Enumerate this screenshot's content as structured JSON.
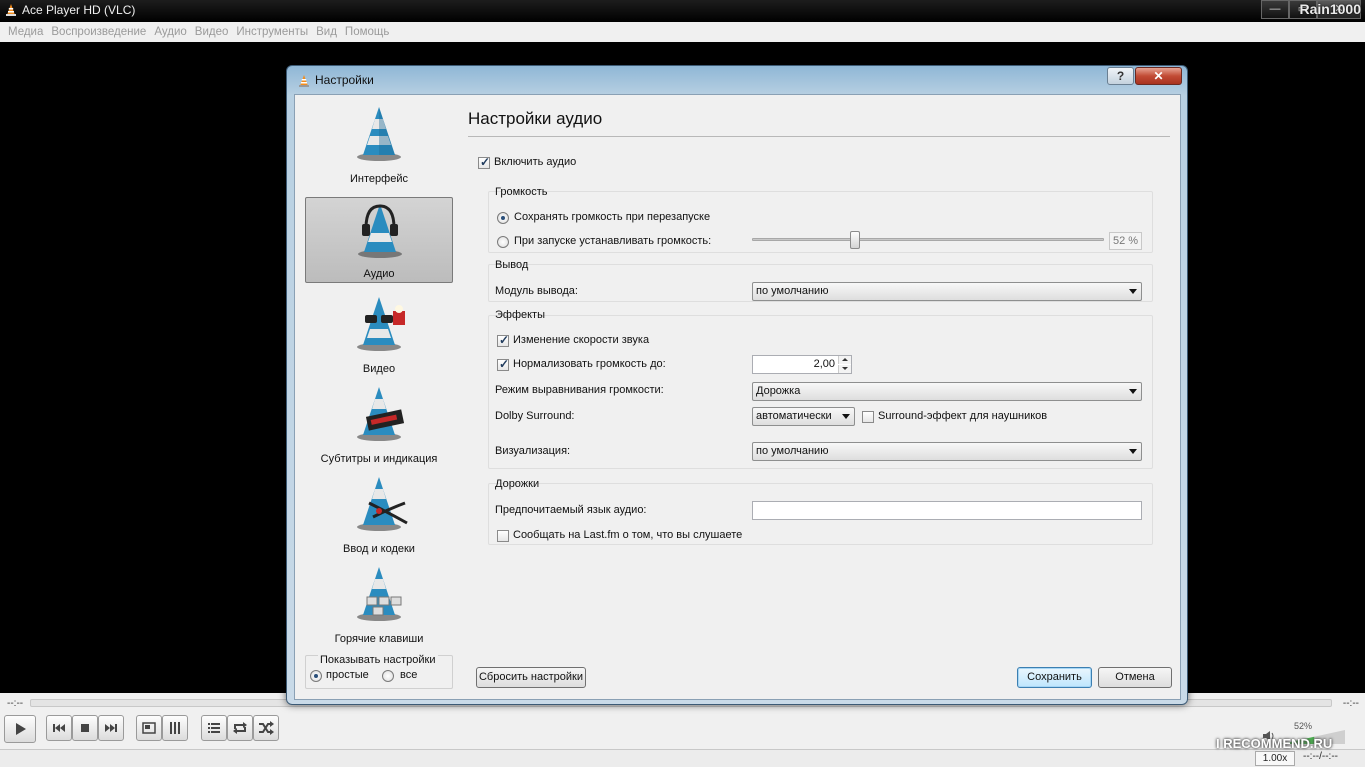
{
  "window": {
    "title": "Ace Player HD (VLC)",
    "min_label": "—",
    "max_label": "▭",
    "close_label": "✕",
    "watermark": "Rain1000"
  },
  "menu": [
    "Медиа",
    "Воспроизведение",
    "Аудио",
    "Видео",
    "Инструменты",
    "Вид",
    "Помощь"
  ],
  "dialog": {
    "title": "Настройки",
    "help_label": "?",
    "close_label": "✕",
    "categories": [
      {
        "label": "Интерфейс",
        "icon": "interface-cone-icon",
        "selected": false
      },
      {
        "label": "Аудио",
        "icon": "audio-headphones-cone-icon",
        "selected": true
      },
      {
        "label": "Видео",
        "icon": "video-glasses-cone-icon",
        "selected": false
      },
      {
        "label": "Субтитры и индикация",
        "icon": "subtitles-display-cone-icon",
        "selected": false
      },
      {
        "label": "Ввод и кодеки",
        "icon": "input-codecs-cone-icon",
        "selected": false
      },
      {
        "label": "Горячие клавиши",
        "icon": "hotkeys-cone-icon",
        "selected": false
      }
    ],
    "show_settings": {
      "legend": "Показывать настройки",
      "simple": "простые",
      "all": "все",
      "selected": "простые"
    },
    "panel": {
      "title": "Настройки аудио",
      "enable_audio": {
        "label": "Включить аудио",
        "checked": true
      },
      "volume": {
        "group": "Громкость",
        "keep_label": "Сохранять громкость при перезапуске",
        "keep_selected": true,
        "set_label": "При запуске устанавливать громкость:",
        "set_selected": false,
        "level_text": "52 %",
        "level_fraction": 0.52
      },
      "output": {
        "group": "Вывод",
        "module_label": "Модуль вывода:",
        "module_value": "по умолчанию"
      },
      "effects": {
        "group": "Эффекты",
        "pitch_label": "Изменение скорости звука",
        "pitch_checked": true,
        "normalize_label": "Нормализовать громкость до:",
        "normalize_checked": true,
        "normalize_value": "2,00",
        "replaygain_label": "Режим выравнивания громкости:",
        "replaygain_value": "Дорожка",
        "dolby_label": "Dolby Surround:",
        "dolby_value": "автоматически",
        "headphones_label": "Surround-эффект для наушников",
        "headphones_checked": false,
        "visual_label": "Визуализация:",
        "visual_value": "по умолчанию"
      },
      "tracks": {
        "group": "Дорожки",
        "lang_label": "Предпочитаемый язык аудио:",
        "lang_value": "",
        "lastfm_label": "Сообщать на Last.fm о том, что вы слушаете",
        "lastfm_checked": false
      }
    },
    "reset_label": "Сбросить настройки",
    "save_label": "Сохранить",
    "cancel_label": "Отмена"
  },
  "player": {
    "time_left": "--:--",
    "time_right": "--:--",
    "volume_text": "52%",
    "volume_fraction": 0.52,
    "speed": "1.00x",
    "duration": "--:--/--:--",
    "watermark": "I RECOMMEND.RU",
    "buttons": [
      "play-icon",
      "prev-icon",
      "stop-icon",
      "next-icon",
      "fullscreen-icon",
      "extended-settings-icon",
      "playlist-icon",
      "loop-icon",
      "shuffle-icon"
    ]
  }
}
